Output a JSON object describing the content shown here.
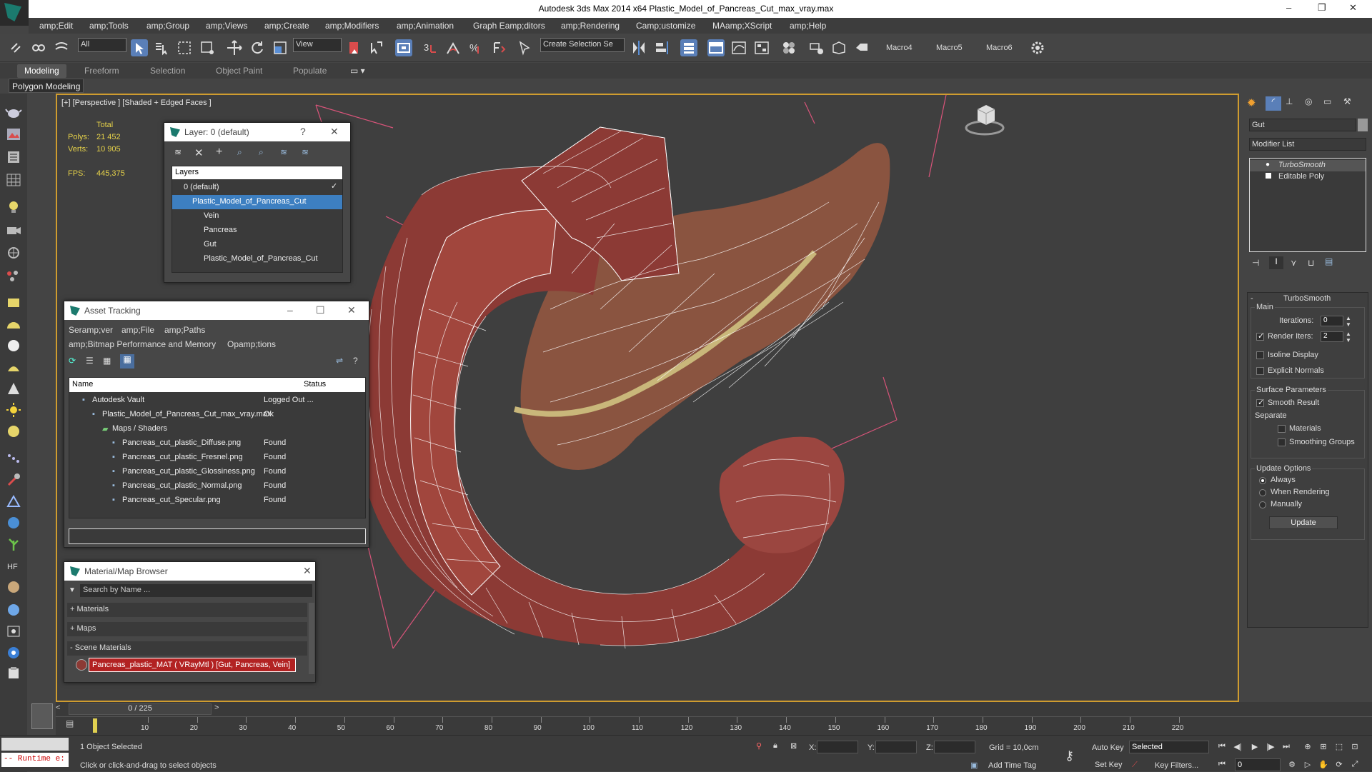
{
  "window": {
    "app_title": "Autodesk 3ds Max  2014 x64    Plastic_Model_of_Pancreas_Cut_max_vray.max",
    "minimize": "–",
    "maximize": "❐",
    "close": "✕"
  },
  "menu": [
    "amp;Edit",
    "amp;Tools",
    "amp;Group",
    "amp;Views",
    "amp;Create",
    "amp;Modifiers",
    "amp;Animation",
    "Graph Eamp;ditors",
    "amp;Rendering",
    "Camp;ustomize",
    "MAamp;XScript",
    "amp;Help"
  ],
  "toolbar": {
    "selection_filter": "All",
    "ref_coord": "View",
    "named_selection": "Create Selection Se",
    "macros": [
      "Macro4",
      "Macro5",
      "Macro6"
    ]
  },
  "ribbon": {
    "tabs": [
      "Modeling",
      "Freeform",
      "Selection",
      "Object Paint",
      "Populate"
    ],
    "active_tab": "Modeling",
    "panel_label": "Polygon Modeling"
  },
  "viewport": {
    "label": "[+] [Perspective ] [Shaded + Edged Faces ]",
    "stats": {
      "total_label": "Total",
      "polys_label": "Polys:",
      "polys_value": "21 452",
      "verts_label": "Verts:",
      "verts_value": "10 905",
      "fps_label": "FPS:",
      "fps_value": "445,375"
    },
    "colors": {
      "model_red": "#8c3a35",
      "wire": "#ffffff",
      "pancreas": "#8a5440",
      "vein": "#c9b77a",
      "border_active": "#cf9c2f"
    }
  },
  "layer_window": {
    "title": "Layer: 0 (default)",
    "help": "?",
    "close": "✕",
    "header": "Layers",
    "items": [
      {
        "label": "0 (default)",
        "indent": 0,
        "selected": false
      },
      {
        "label": "Plastic_Model_of_Pancreas_Cut",
        "indent": 0,
        "selected": true
      },
      {
        "label": "Vein",
        "indent": 1,
        "selected": false
      },
      {
        "label": "Pancreas",
        "indent": 1,
        "selected": false
      },
      {
        "label": "Gut",
        "indent": 1,
        "selected": false
      },
      {
        "label": "Plastic_Model_of_Pancreas_Cut",
        "indent": 1,
        "selected": false
      }
    ]
  },
  "asset_tracking": {
    "title": "Asset Tracking",
    "menu_row1": [
      "Seramp;ver",
      "amp;File",
      "amp;Paths"
    ],
    "menu_row2": [
      "amp;Bitmap Performance and Memory",
      "Opamp;tions"
    ],
    "columns": [
      "Name",
      "Status"
    ],
    "rows": [
      {
        "name": "Autodesk Vault",
        "status": "Logged Out ...",
        "indent": 1
      },
      {
        "name": "Plastic_Model_of_Pancreas_Cut_max_vray.max",
        "status": "Ok",
        "indent": 2
      },
      {
        "name": "Maps / Shaders",
        "status": "",
        "indent": 3
      },
      {
        "name": "Pancreas_cut_plastic_Diffuse.png",
        "status": "Found",
        "indent": 4
      },
      {
        "name": "Pancreas_cut_plastic_Fresnel.png",
        "status": "Found",
        "indent": 4
      },
      {
        "name": "Pancreas_cut_plastic_Glossiness.png",
        "status": "Found",
        "indent": 4
      },
      {
        "name": "Pancreas_cut_plastic_Normal.png",
        "status": "Found",
        "indent": 4
      },
      {
        "name": "Pancreas_cut_Specular.png",
        "status": "Found",
        "indent": 4
      }
    ]
  },
  "material_browser": {
    "title": "Material/Map Browser",
    "close": "✕",
    "search_placeholder": "Search by Name ...",
    "sections": [
      "+ Materials",
      "+ Maps",
      "- Scene Materials"
    ],
    "scene_material": "Pancreas_plastic_MAT  ( VRayMtl )  [Gut, Pancreas, Vein]"
  },
  "command_panel": {
    "object_name": "Gut",
    "modifier_list": "Modifier List",
    "stack": [
      "TurboSmooth",
      "Editable Poly"
    ],
    "rollout_title": "TurboSmooth",
    "main_group": "Main",
    "iterations_label": "Iterations:",
    "iterations_value": "0",
    "render_iters_label": "Render Iters:",
    "render_iters_value": "2",
    "isoline_label": "Isoline Display",
    "explicit_normals_label": "Explicit Normals",
    "surface_group": "Surface Parameters",
    "smooth_result_label": "Smooth Result",
    "separate_label": "Separate",
    "materials_label": "Materials",
    "smoothing_groups_label": "Smoothing Groups",
    "update_group": "Update Options",
    "always_label": "Always",
    "when_rendering_label": "When Rendering",
    "manually_label": "Manually",
    "update_button": "Update"
  },
  "timeline": {
    "frame_display": "0 / 225",
    "ticks": [
      "10",
      "20",
      "30",
      "40",
      "50",
      "60",
      "70",
      "80",
      "90",
      "100",
      "110",
      "120",
      "130",
      "140",
      "150",
      "160",
      "170",
      "180",
      "190",
      "200",
      "210",
      "220"
    ]
  },
  "status": {
    "script_listener": "-- Runtime e:",
    "selection_info": "1 Object Selected",
    "prompt": "Click or click-and-drag to select objects",
    "x_label": "X:",
    "y_label": "Y:",
    "z_label": "Z:",
    "grid": "Grid = 10,0cm",
    "add_time_tag": "Add Time Tag",
    "auto_key": "Auto Key",
    "auto_key_mode": "Selected",
    "set_key": "Set Key",
    "key_filters": "Key Filters...",
    "current_frame": "0"
  }
}
